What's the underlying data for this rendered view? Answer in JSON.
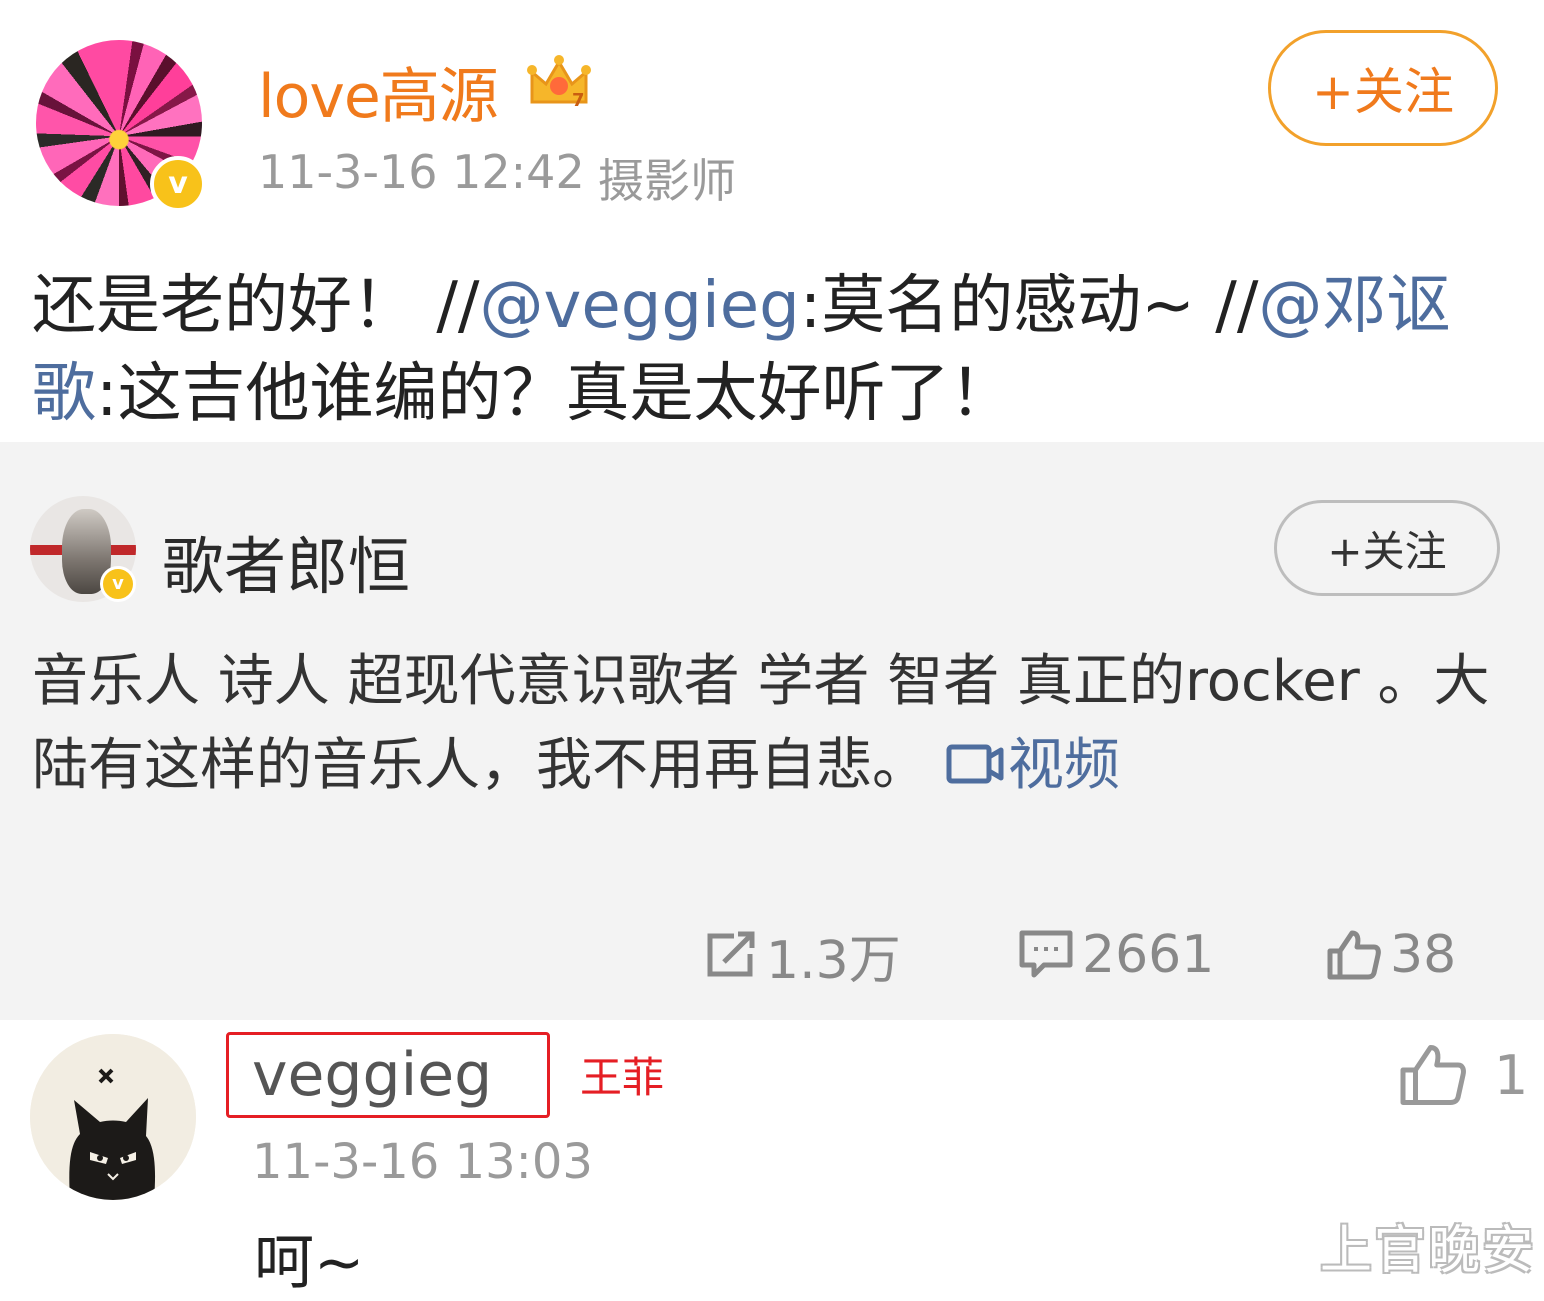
{
  "post": {
    "user_name": "love高源",
    "time": "11-3-16 12:42",
    "source": "摄影师",
    "follow_label": "+关注",
    "text_1": "还是老的好！ //",
    "mention_1": "@veggieg",
    "text_2": ":莫名的感动~ //",
    "mention_2": "@邓讴歌",
    "text_3": ":这吉他谁编的？真是太好听了！"
  },
  "retweet": {
    "user_name": "歌者郎恒",
    "follow_label": "+关注",
    "text": "音乐人 诗人 超现代意识歌者  学者 智者 真正的rocker 。大陆有这样的音乐人，我不用再自悲。 ",
    "video_link": "视频",
    "reposts": "1.3万",
    "comments": "2661",
    "likes": "38"
  },
  "comment": {
    "user_name": "veggieg",
    "annotation": "王菲",
    "time": "11-3-16 13:03",
    "text": "呵~",
    "likes": "1"
  },
  "watermark": "上官晚安",
  "colors": {
    "orange": "#f07a1c",
    "link_blue": "#4e6d9e",
    "verified_badge": "#f8c21a",
    "highlight_red": "#e51e24",
    "card_bg": "#f3f3f3"
  },
  "icons": [
    "verified-icon",
    "crown-icon",
    "video-icon",
    "repost-icon",
    "comment-icon",
    "like-icon"
  ]
}
